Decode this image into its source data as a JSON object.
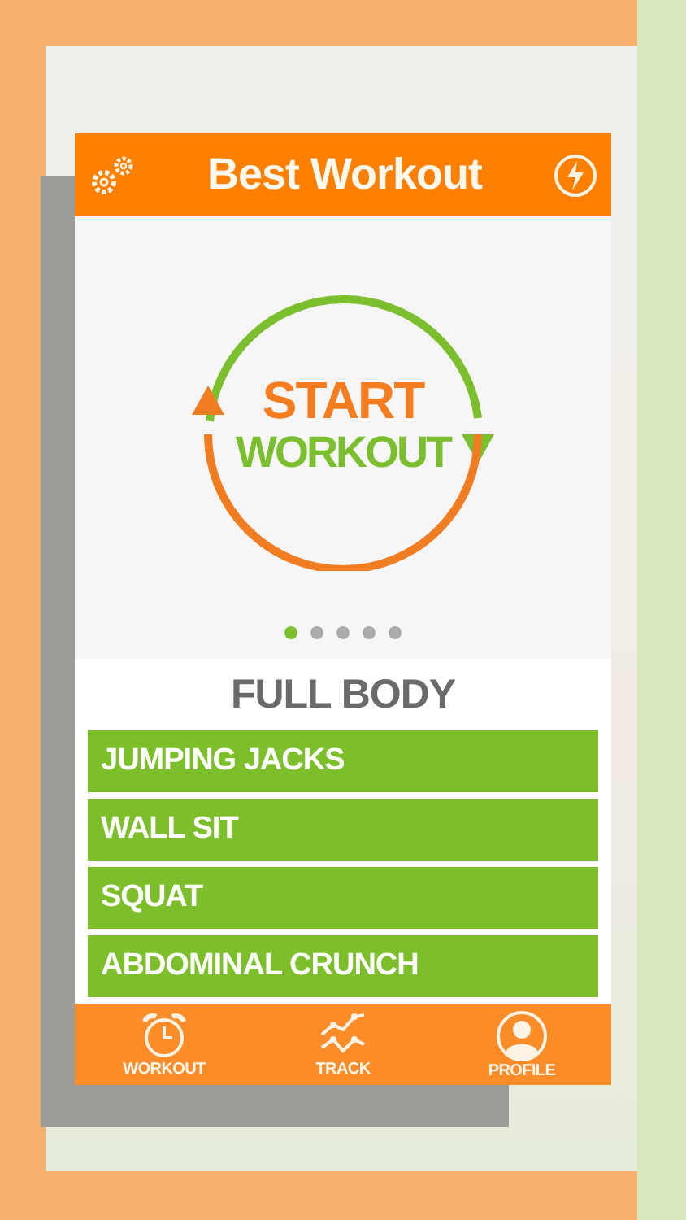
{
  "header": {
    "title": "Best Workout"
  },
  "hero": {
    "line_1": "START",
    "line_2": "WORKOUT"
  },
  "page_dots": [
    {
      "selected": true
    },
    {
      "selected": false
    },
    {
      "selected": false
    },
    {
      "selected": false
    },
    {
      "selected": false
    }
  ],
  "section_title": "FULL BODY",
  "exercises": [
    {
      "name": "JUMPING JACKS"
    },
    {
      "name": "WALL SIT"
    },
    {
      "name": "SQUAT"
    },
    {
      "name": "ABDOMINAL CRUNCH"
    }
  ],
  "tab_bar": [
    {
      "label": "WORKOUT"
    },
    {
      "label": "TRACK"
    },
    {
      "label": "PROFILE"
    }
  ]
}
